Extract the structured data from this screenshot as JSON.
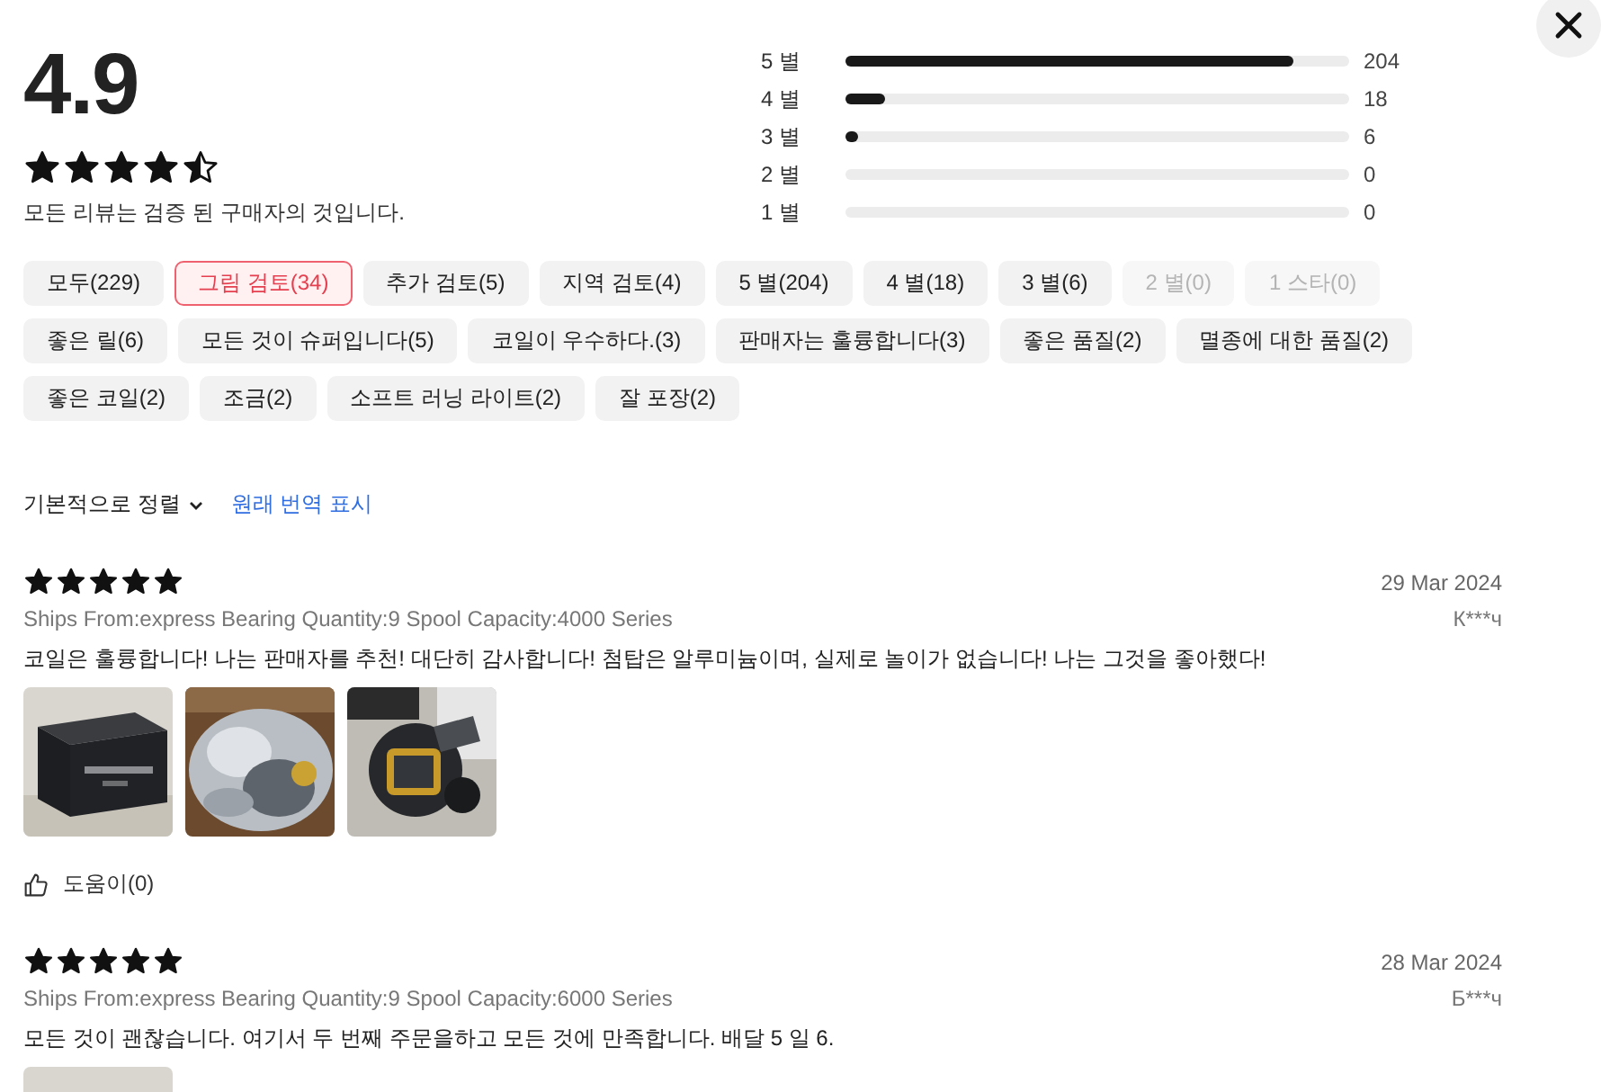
{
  "summary": {
    "rating": "4.9",
    "stars": 4.5,
    "note": "모든 리뷰는 검증 된 구매자의 것입니다."
  },
  "histogram": [
    {
      "label": "5 별",
      "level": 0.89,
      "count": "204"
    },
    {
      "label": "4 별",
      "level": 0.08,
      "count": "18"
    },
    {
      "label": "3 별",
      "level": 0.025,
      "count": "6"
    },
    {
      "label": "2 별",
      "count": "0"
    },
    {
      "label": "1 별",
      "count": "0"
    }
  ],
  "filters": [
    {
      "label": "모두(229)",
      "selected": false,
      "disabled": false
    },
    {
      "label": "그림 검토(34)",
      "selected": true,
      "disabled": false
    },
    {
      "label": "추가 검토(5)",
      "selected": false,
      "disabled": false
    },
    {
      "label": "지역 검토(4)",
      "selected": false,
      "disabled": false
    },
    {
      "label": "5 별(204)",
      "selected": false,
      "disabled": false
    },
    {
      "label": "4 별(18)",
      "selected": false,
      "disabled": false
    },
    {
      "label": "3 별(6)",
      "selected": false,
      "disabled": false
    },
    {
      "label": "2 별(0)",
      "selected": false,
      "disabled": true
    },
    {
      "label": "1 스타(0)",
      "selected": false,
      "disabled": true
    },
    {
      "label": "좋은 릴(6)",
      "selected": false,
      "disabled": false
    },
    {
      "label": "모든 것이 슈퍼입니다(5)",
      "selected": false,
      "disabled": false
    },
    {
      "label": "코일이 우수하다.(3)",
      "selected": false,
      "disabled": false
    },
    {
      "label": "판매자는 훌륭합니다(3)",
      "selected": false,
      "disabled": false
    },
    {
      "label": "좋은 품질(2)",
      "selected": false,
      "disabled": false
    },
    {
      "label": "멸종에 대한 품질(2)",
      "selected": false,
      "disabled": false
    },
    {
      "label": "좋은 코일(2)",
      "selected": false,
      "disabled": false
    },
    {
      "label": "조금(2)",
      "selected": false,
      "disabled": false
    },
    {
      "label": "소프트 러닝 라이트(2)",
      "selected": false,
      "disabled": false
    },
    {
      "label": "잘 포장(2)",
      "selected": false,
      "disabled": false
    }
  ],
  "sort": {
    "label": "기본적으로 정렬"
  },
  "translate_link": "원래 번역 표시",
  "reviews": [
    {
      "stars": 5,
      "date": "29 Mar 2024",
      "meta": "Ships From:express Bearing Quantity:9 Spool Capacity:4000 Series",
      "author": "К***ч",
      "text": "코일은 훌륭합니다! 나는 판매자를 추천! 대단히 감사합니다! 첨탑은 알루미늄이며, 실제로 놀이가 없습니다! 나는 그것을 좋아했다!",
      "photos": [
        {
          "kind": "picture"
        },
        {
          "kind": "picture"
        },
        {
          "kind": "picture"
        }
      ],
      "helpful": "도움이(0)"
    },
    {
      "stars": 5,
      "date": "28 Mar 2024",
      "meta": "Ships From:express Bearing Quantity:9 Spool Capacity:6000 Series",
      "author": "Б***ч",
      "text": "모든 것이 괜찮습니다. 여기서 두 번째 주문을하고 모든 것에 만족합니다. 배달 5 일 6.",
      "photos": [
        {
          "kind": "picture"
        }
      ]
    }
  ]
}
